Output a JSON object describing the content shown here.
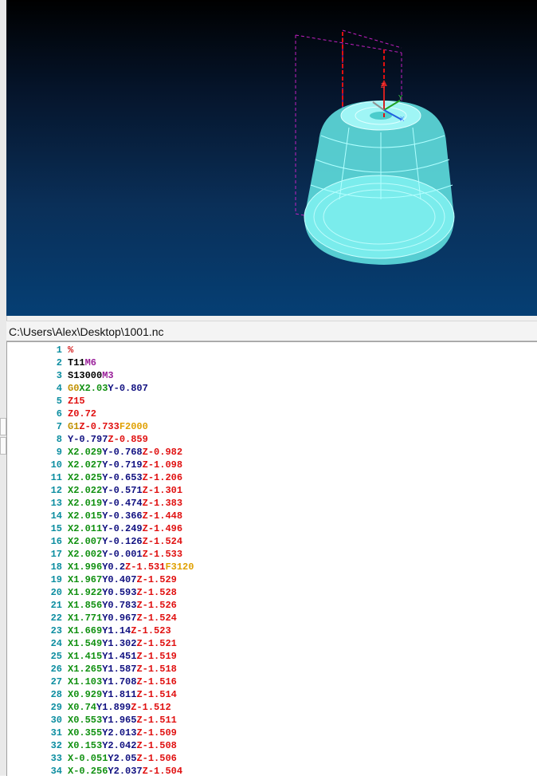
{
  "window": {
    "file_path": "C:\\Users\\Alex\\Desktop\\1001.nc"
  },
  "viewport": {
    "background_top": "#000000",
    "background_bottom": "#053f74",
    "toolpath_color": "#7fffff",
    "rapid_color": "#e01010",
    "boundary_color": "#c020c0"
  },
  "axes": {
    "x_label": "X",
    "y_label": "Y",
    "z_label": "Z"
  },
  "colors": {
    "line_number": "#0b8da0",
    "x": "#109010",
    "y": "#101080",
    "z": "#e01010",
    "g": "#c09000",
    "f": "#e0a000",
    "m": "#9a1f9a",
    "text": "#000000"
  },
  "lines": [
    {
      "n": "1",
      "tokens": [
        {
          "t": "%",
          "c": "pct"
        }
      ]
    },
    {
      "n": "2",
      "tokens": [
        {
          "t": "T11",
          "c": "t"
        },
        {
          "t": "M6",
          "c": "m"
        }
      ]
    },
    {
      "n": "3",
      "tokens": [
        {
          "t": "S13000",
          "c": "s"
        },
        {
          "t": "M3",
          "c": "m"
        }
      ]
    },
    {
      "n": "4",
      "tokens": [
        {
          "t": "G0",
          "c": "g"
        },
        {
          "t": "X2.03",
          "c": "x"
        },
        {
          "t": "Y-0.807",
          "c": "y"
        }
      ]
    },
    {
      "n": "5",
      "tokens": [
        {
          "t": "Z15",
          "c": "z"
        }
      ]
    },
    {
      "n": "6",
      "tokens": [
        {
          "t": "Z0.72",
          "c": "z"
        }
      ]
    },
    {
      "n": "7",
      "tokens": [
        {
          "t": "G1",
          "c": "g"
        },
        {
          "t": "Z-0.733",
          "c": "z"
        },
        {
          "t": "F2000",
          "c": "f"
        }
      ]
    },
    {
      "n": "8",
      "tokens": [
        {
          "t": "Y-0.797",
          "c": "y"
        },
        {
          "t": "Z-0.859",
          "c": "z"
        }
      ]
    },
    {
      "n": "9",
      "tokens": [
        {
          "t": "X2.029",
          "c": "x"
        },
        {
          "t": "Y-0.768",
          "c": "y"
        },
        {
          "t": "Z-0.982",
          "c": "z"
        }
      ]
    },
    {
      "n": "10",
      "tokens": [
        {
          "t": "X2.027",
          "c": "x"
        },
        {
          "t": "Y-0.719",
          "c": "y"
        },
        {
          "t": "Z-1.098",
          "c": "z"
        }
      ]
    },
    {
      "n": "11",
      "tokens": [
        {
          "t": "X2.025",
          "c": "x"
        },
        {
          "t": "Y-0.653",
          "c": "y"
        },
        {
          "t": "Z-1.206",
          "c": "z"
        }
      ]
    },
    {
      "n": "12",
      "tokens": [
        {
          "t": "X2.022",
          "c": "x"
        },
        {
          "t": "Y-0.571",
          "c": "y"
        },
        {
          "t": "Z-1.301",
          "c": "z"
        }
      ]
    },
    {
      "n": "13",
      "tokens": [
        {
          "t": "X2.019",
          "c": "x"
        },
        {
          "t": "Y-0.474",
          "c": "y"
        },
        {
          "t": "Z-1.383",
          "c": "z"
        }
      ]
    },
    {
      "n": "14",
      "tokens": [
        {
          "t": "X2.015",
          "c": "x"
        },
        {
          "t": "Y-0.366",
          "c": "y"
        },
        {
          "t": "Z-1.448",
          "c": "z"
        }
      ]
    },
    {
      "n": "15",
      "tokens": [
        {
          "t": "X2.011",
          "c": "x"
        },
        {
          "t": "Y-0.249",
          "c": "y"
        },
        {
          "t": "Z-1.496",
          "c": "z"
        }
      ]
    },
    {
      "n": "16",
      "tokens": [
        {
          "t": "X2.007",
          "c": "x"
        },
        {
          "t": "Y-0.126",
          "c": "y"
        },
        {
          "t": "Z-1.524",
          "c": "z"
        }
      ]
    },
    {
      "n": "17",
      "tokens": [
        {
          "t": "X2.002",
          "c": "x"
        },
        {
          "t": "Y-0.001",
          "c": "y"
        },
        {
          "t": "Z-1.533",
          "c": "z"
        }
      ]
    },
    {
      "n": "18",
      "tokens": [
        {
          "t": "X1.996",
          "c": "x"
        },
        {
          "t": "Y0.2",
          "c": "y"
        },
        {
          "t": "Z-1.531",
          "c": "z"
        },
        {
          "t": "F3120",
          "c": "f"
        }
      ]
    },
    {
      "n": "19",
      "tokens": [
        {
          "t": "X1.967",
          "c": "x"
        },
        {
          "t": "Y0.407",
          "c": "y"
        },
        {
          "t": "Z-1.529",
          "c": "z"
        }
      ]
    },
    {
      "n": "20",
      "tokens": [
        {
          "t": "X1.922",
          "c": "x"
        },
        {
          "t": "Y0.593",
          "c": "y"
        },
        {
          "t": "Z-1.528",
          "c": "z"
        }
      ]
    },
    {
      "n": "21",
      "tokens": [
        {
          "t": "X1.856",
          "c": "x"
        },
        {
          "t": "Y0.783",
          "c": "y"
        },
        {
          "t": "Z-1.526",
          "c": "z"
        }
      ]
    },
    {
      "n": "22",
      "tokens": [
        {
          "t": "X1.771",
          "c": "x"
        },
        {
          "t": "Y0.967",
          "c": "y"
        },
        {
          "t": "Z-1.524",
          "c": "z"
        }
      ]
    },
    {
      "n": "23",
      "tokens": [
        {
          "t": "X1.669",
          "c": "x"
        },
        {
          "t": "Y1.14",
          "c": "y"
        },
        {
          "t": "Z-1.523",
          "c": "z"
        }
      ]
    },
    {
      "n": "24",
      "tokens": [
        {
          "t": "X1.549",
          "c": "x"
        },
        {
          "t": "Y1.302",
          "c": "y"
        },
        {
          "t": "Z-1.521",
          "c": "z"
        }
      ]
    },
    {
      "n": "25",
      "tokens": [
        {
          "t": "X1.415",
          "c": "x"
        },
        {
          "t": "Y1.451",
          "c": "y"
        },
        {
          "t": "Z-1.519",
          "c": "z"
        }
      ]
    },
    {
      "n": "26",
      "tokens": [
        {
          "t": "X1.265",
          "c": "x"
        },
        {
          "t": "Y1.587",
          "c": "y"
        },
        {
          "t": "Z-1.518",
          "c": "z"
        }
      ]
    },
    {
      "n": "27",
      "tokens": [
        {
          "t": "X1.103",
          "c": "x"
        },
        {
          "t": "Y1.708",
          "c": "y"
        },
        {
          "t": "Z-1.516",
          "c": "z"
        }
      ]
    },
    {
      "n": "28",
      "tokens": [
        {
          "t": "X0.929",
          "c": "x"
        },
        {
          "t": "Y1.811",
          "c": "y"
        },
        {
          "t": "Z-1.514",
          "c": "z"
        }
      ]
    },
    {
      "n": "29",
      "tokens": [
        {
          "t": "X0.74",
          "c": "x"
        },
        {
          "t": "Y1.899",
          "c": "y"
        },
        {
          "t": "Z-1.512",
          "c": "z"
        }
      ]
    },
    {
      "n": "30",
      "tokens": [
        {
          "t": "X0.553",
          "c": "x"
        },
        {
          "t": "Y1.965",
          "c": "y"
        },
        {
          "t": "Z-1.511",
          "c": "z"
        }
      ]
    },
    {
      "n": "31",
      "tokens": [
        {
          "t": "X0.355",
          "c": "x"
        },
        {
          "t": "Y2.013",
          "c": "y"
        },
        {
          "t": "Z-1.509",
          "c": "z"
        }
      ]
    },
    {
      "n": "32",
      "tokens": [
        {
          "t": "X0.153",
          "c": "x"
        },
        {
          "t": "Y2.042",
          "c": "y"
        },
        {
          "t": "Z-1.508",
          "c": "z"
        }
      ]
    },
    {
      "n": "33",
      "tokens": [
        {
          "t": "X-0.051",
          "c": "x"
        },
        {
          "t": "Y2.05",
          "c": "y"
        },
        {
          "t": "Z-1.506",
          "c": "z"
        }
      ]
    },
    {
      "n": "34",
      "tokens": [
        {
          "t": "X-0.256",
          "c": "x"
        },
        {
          "t": "Y2.037",
          "c": "y"
        },
        {
          "t": "Z-1.504",
          "c": "z"
        }
      ]
    }
  ]
}
